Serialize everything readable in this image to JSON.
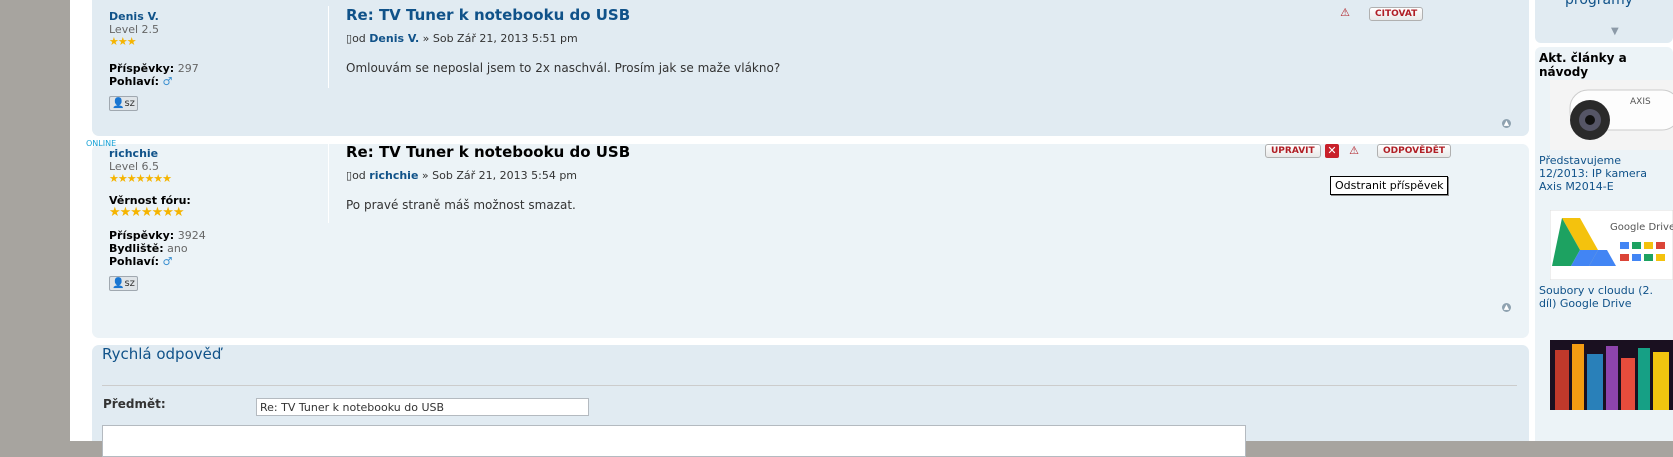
{
  "post1": {
    "username": "Denis V.",
    "rank": "Level 2.5",
    "rank_stars": "★★★",
    "posts_label": "Příspěvky:",
    "posts_value": "297",
    "gender_label": "Pohlaví:",
    "gender_icon": "male-symbol",
    "pm_label": "sz",
    "title": "Re: TV Tuner k notebooku do USB",
    "author_prefix": "od",
    "author_name": "Denis V.",
    "author_date": "» Sob Zář 21, 2013 5:51 pm",
    "body": "Omlouvám se neposlal jsem to 2x naschvál. Prosím jak se maže vlákno?",
    "quote_label": "CITOVAT"
  },
  "post2": {
    "online": "ONLINE",
    "username": "richchie",
    "rank": "Level 6.5",
    "rank_stars": "★★★★★★★",
    "loyalty_label": "Věrnost fóru:",
    "loyalty_stars": "★★★★★★★",
    "posts_label": "Příspěvky:",
    "posts_value": "3924",
    "location_label": "Bydliště:",
    "location_value": "ano",
    "gender_label": "Pohlaví:",
    "gender_icon": "male-symbol",
    "pm_label": "sz",
    "title": "Re: TV Tuner k notebooku do USB",
    "author_prefix": "od",
    "author_name": "richchie",
    "author_date": "» Sob Zář 21, 2013 5:54 pm",
    "body": "Po pravé straně máš možnost smazat.",
    "edit_label": "UPRAVIT",
    "reply_label": "ODPOVĚDĚT",
    "tooltip": "Odstranit příspěvek"
  },
  "quick_reply": {
    "heading": "Rychlá odpověď",
    "subject_label": "Předmět:",
    "subject_value": "Re: TV Tuner k notebooku do USB"
  },
  "sidebar": {
    "top_text": "programy",
    "section_title": "Akt. články a návody",
    "articles": [
      {
        "title": "Představujeme 12/2013: IP kamera Axis M2014-E"
      },
      {
        "title": "Soubory v cloudu (2. díl) Google Drive"
      }
    ]
  }
}
